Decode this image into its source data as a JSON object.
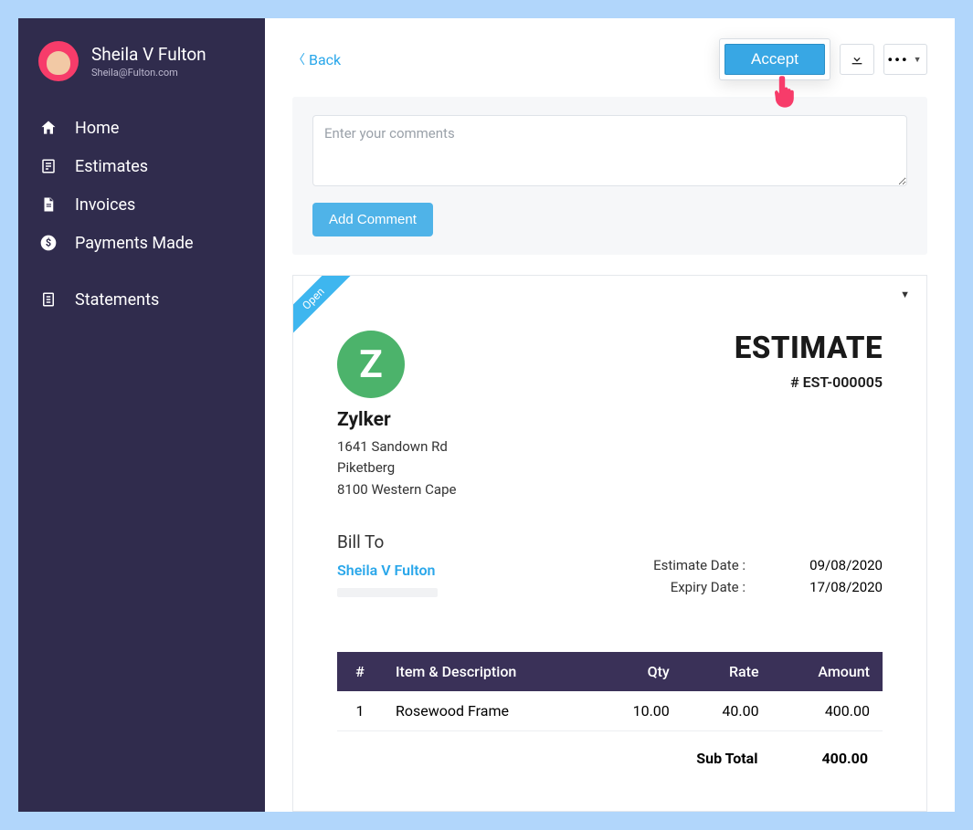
{
  "profile": {
    "name": "Sheila V Fulton",
    "email": "Sheila@Fulton.com"
  },
  "nav": {
    "home": "Home",
    "estimates": "Estimates",
    "invoices": "Invoices",
    "payments": "Payments Made",
    "statements": "Statements"
  },
  "topbar": {
    "back": "Back",
    "accept": "Accept"
  },
  "comments": {
    "placeholder": "Enter your comments",
    "add_button": "Add Comment"
  },
  "document": {
    "ribbon": "Open",
    "org": {
      "logo_letter": "Z",
      "name": "Zylker",
      "addr1": "1641 Sandown Rd",
      "addr2": "Piketberg",
      "addr3": "8100 Western Cape"
    },
    "title": "ESTIMATE",
    "number": "# EST-000005",
    "bill_to_label": "Bill To",
    "bill_to_name": "Sheila V Fulton",
    "dates": {
      "estimate_label": "Estimate Date :",
      "estimate_value": "09/08/2020",
      "expiry_label": "Expiry Date :",
      "expiry_value": "17/08/2020"
    },
    "table": {
      "headers": {
        "idx": "#",
        "desc": "Item & Description",
        "qty": "Qty",
        "rate": "Rate",
        "amount": "Amount"
      },
      "row1": {
        "idx": "1",
        "desc": "Rosewood Frame",
        "qty": "10.00",
        "rate": "40.00",
        "amount": "400.00"
      }
    },
    "subtotal_label": "Sub Total",
    "subtotal_value": "400.00"
  }
}
